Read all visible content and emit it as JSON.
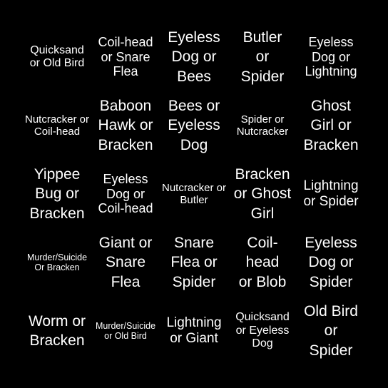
{
  "board": {
    "background": "#000000",
    "text_color": "#ffffff",
    "cells": [
      [
        "Quicksand or Old Bird",
        "Coil-head or Snare Flea",
        "Eyeless Dog or Bees",
        "Butler or Spider",
        "Eyeless Dog or Lightning"
      ],
      [
        "Nutcracker or Coil-head",
        "Baboon Hawk or Bracken",
        "Bees or Eyeless Dog",
        "Spider or Nutcracker",
        "Ghost Girl or Bracken"
      ],
      [
        "Yippee Bug or Bracken",
        "Eyeless Dog or Coil-head",
        "Nutcracker or Butler",
        "Bracken or Ghost Girl",
        "Lightning or Spider"
      ],
      [
        "Murder/Suicide Or Bracken",
        "Giant or Snare Flea",
        "Snare Flea or Spider",
        "Coil-head or Blob",
        "Eyeless Dog or Spider"
      ],
      [
        "Worm or Bracken",
        "Murder/Suicide or Old Bird",
        "Lightning or Giant",
        "Quicksand or Eyeless Dog",
        "Old Bird or Spider"
      ]
    ]
  }
}
